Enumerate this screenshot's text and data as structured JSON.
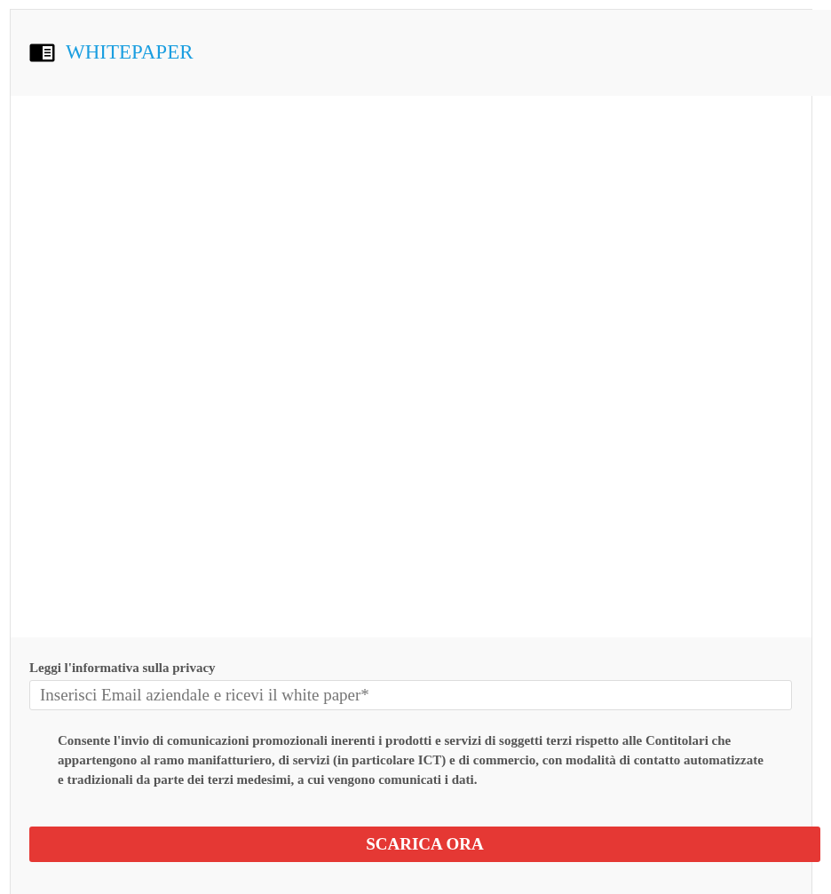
{
  "header": {
    "title": "WHITEPAPER"
  },
  "form": {
    "privacy_link": "Leggi l'informativa sulla privacy",
    "email": {
      "placeholder": "Inserisci Email aziendale e ricevi il white paper*"
    },
    "consent": "Consente l'invio di comunicazioni promozionali inerenti i prodotti e servizi di soggetti terzi rispetto alle Contitolari che appartengono al ramo manifatturiero, di servizi (in particolare ICT) e di commercio, con modalità di contatto automatizzate e tradizionali da parte dei terzi medesimi, a cui vengono comunicati i dati.",
    "submit": "SCARICA ORA"
  }
}
